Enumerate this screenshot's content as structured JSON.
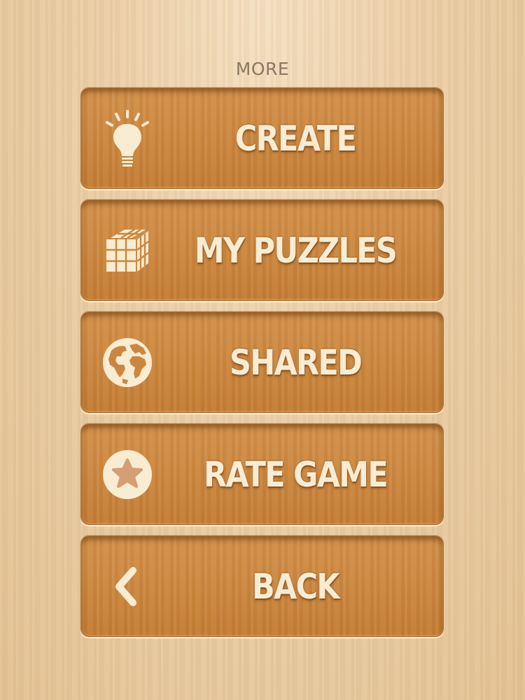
{
  "screen": {
    "title": "MORE"
  },
  "menu": {
    "items": [
      {
        "id": "create",
        "label": "CREATE",
        "icon": "lightbulb-icon"
      },
      {
        "id": "my_puzzles",
        "label": "MY PUZZLES",
        "icon": "puzzle-cube-icon"
      },
      {
        "id": "shared",
        "label": "SHARED",
        "icon": "globe-icon"
      },
      {
        "id": "rate_game",
        "label": "RATE GAME",
        "icon": "star-icon"
      },
      {
        "id": "back",
        "label": "BACK",
        "icon": "chevron-left-icon"
      }
    ]
  },
  "colors": {
    "button_wood": "#cb873f",
    "label_cream": "#f8ecd2",
    "title_gray": "#8a7864",
    "background_wood": "#ecd0a8"
  }
}
